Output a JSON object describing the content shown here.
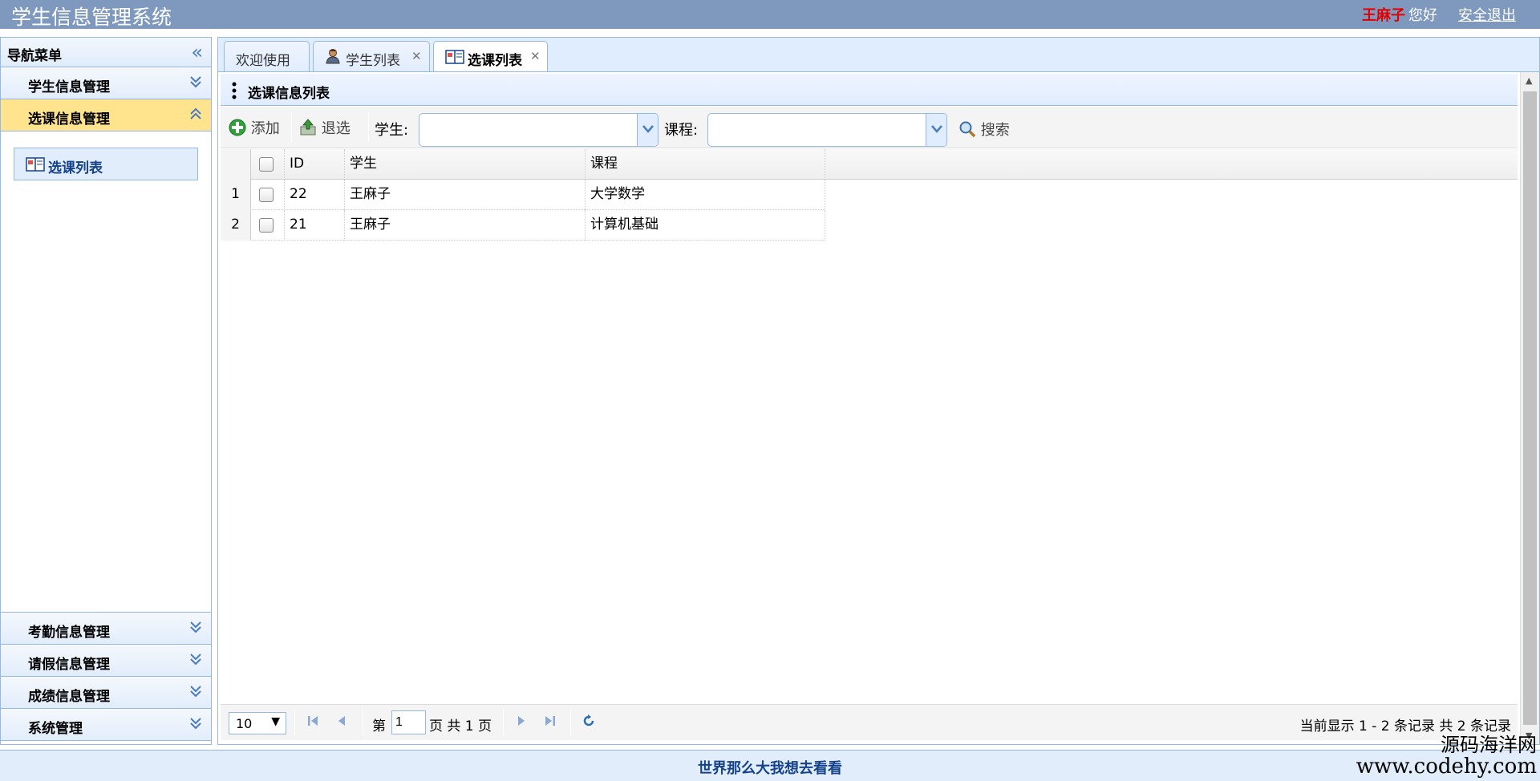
{
  "header": {
    "app_title": "学生信息管理系统",
    "user_name": "王麻子",
    "greeting": "您好",
    "logout_label": "安全退出"
  },
  "sidebar": {
    "title": "导航菜单",
    "groups": [
      {
        "label": "学生信息管理",
        "expanded": false
      },
      {
        "label": "选课信息管理",
        "expanded": true,
        "items": [
          {
            "label": "选课列表",
            "icon": "book-icon"
          }
        ]
      },
      {
        "label": "考勤信息管理",
        "expanded": false
      },
      {
        "label": "请假信息管理",
        "expanded": false
      },
      {
        "label": "成绩信息管理",
        "expanded": false
      },
      {
        "label": "系统管理",
        "expanded": false
      }
    ]
  },
  "tabs": [
    {
      "label": "欢迎使用",
      "closable": false,
      "active": false
    },
    {
      "label": "学生列表",
      "closable": true,
      "active": false,
      "icon": "student-icon"
    },
    {
      "label": "选课列表",
      "closable": true,
      "active": true,
      "icon": "book-icon"
    }
  ],
  "panel": {
    "title": "选课信息列表"
  },
  "toolbar": {
    "add_label": "添加",
    "withdraw_label": "退选",
    "student_label": "学生:",
    "student_value": "",
    "course_label": "课程:",
    "course_value": "",
    "search_label": "搜索"
  },
  "grid": {
    "columns": [
      "ID",
      "学生",
      "课程"
    ],
    "rows": [
      {
        "num": "1",
        "id": "22",
        "student": "王麻子",
        "course": "大学数学"
      },
      {
        "num": "2",
        "id": "21",
        "student": "王麻子",
        "course": "计算机基础"
      }
    ]
  },
  "pager": {
    "page_size": "10",
    "page_prefix": "第",
    "current_page": "1",
    "page_suffix": "页 共 1 页",
    "info": "当前显示 1 - 2 条记录 共 2 条记录"
  },
  "footer": {
    "text": "世界那么大我想去看看"
  },
  "watermark": {
    "line1": "源码海洋网",
    "line2": "www.codehy.com"
  },
  "colors": {
    "header_bg": "#7f99be",
    "accent_border": "#95b8e7",
    "active_group": "#ffe48d",
    "user_name": "#e00000"
  }
}
